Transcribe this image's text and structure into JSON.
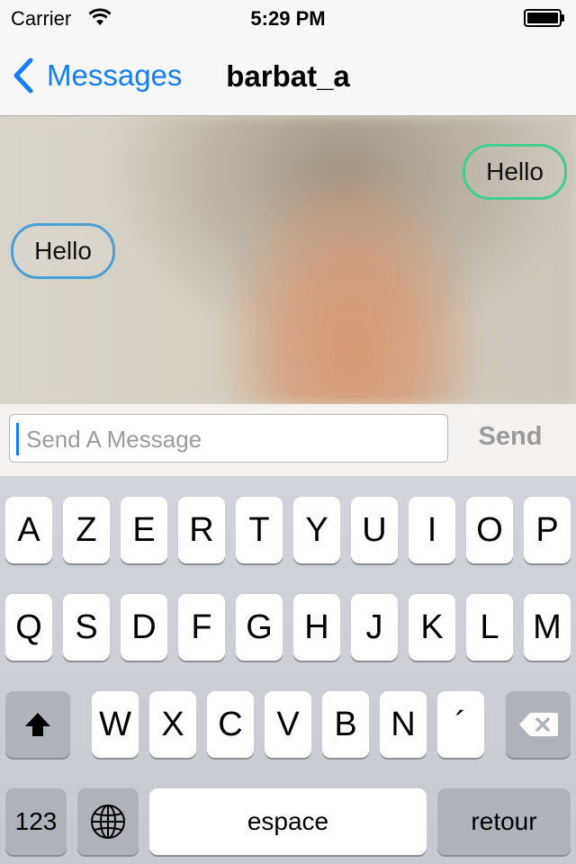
{
  "status_bar": {
    "carrier": "Carrier",
    "time": "5:29 PM"
  },
  "nav": {
    "back_label": "Messages",
    "title": "barbat_a"
  },
  "chat": {
    "messages": [
      {
        "text": "Hello",
        "side": "sent",
        "border_color": "#3ecf8e"
      },
      {
        "text": "Hello",
        "side": "received",
        "border_color": "#4a9fd8"
      }
    ]
  },
  "composer": {
    "placeholder": "Send A Message",
    "value": "",
    "send_label": "Send"
  },
  "keyboard": {
    "row1": [
      "A",
      "Z",
      "E",
      "R",
      "T",
      "Y",
      "U",
      "I",
      "O",
      "P"
    ],
    "row2": [
      "Q",
      "S",
      "D",
      "F",
      "G",
      "H",
      "J",
      "K",
      "L",
      "M"
    ],
    "row3": [
      "W",
      "X",
      "C",
      "V",
      "B",
      "N",
      "´"
    ],
    "numbers_label": "123",
    "space_label": "espace",
    "return_label": "retour"
  },
  "colors": {
    "accent": "#147efb",
    "sent_border": "#3ecf8e",
    "received_border": "#4a9fd8"
  },
  "icons": [
    "wifi-icon",
    "battery-icon",
    "chevron-left-icon",
    "shift-icon",
    "backspace-icon",
    "globe-icon"
  ]
}
